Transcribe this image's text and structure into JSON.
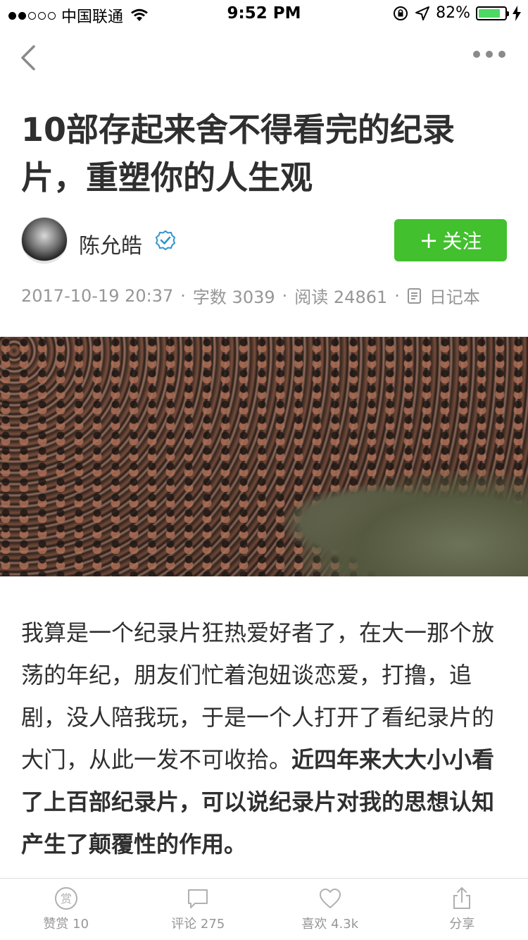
{
  "status_bar": {
    "carrier": "中国联通",
    "time": "9:52 PM",
    "battery": "82%",
    "battery_level": 0.82,
    "signal_bars_filled": 2,
    "signal_bars_total": 5
  },
  "nav": {
    "back_icon": "chevron-left-icon",
    "more_icon": "more-dots-icon"
  },
  "article": {
    "title": "10部存起来舍不得看完的纪录片，重塑你的人生观",
    "author": "陈允皓",
    "verified_icon": "verified-check-icon",
    "follow_label": "关注",
    "date": "2017-10-19 20:37",
    "word_count": "字数 3039",
    "read_count": "阅读 24861",
    "collection": "日记本",
    "body_normal": "我算是一个纪录片狂热爱好者了，在大一那个放荡的年纪，朋友们忙着泡妞谈恋爱，打撸，追剧，没人陪我玩，于是一个人打开了看纪录片的大门，从此一发不可收拾。",
    "body_bold": "近四年来大大小小看了上百部纪录片，可以说纪录片对我的思想认知产生了颠覆性的作用。"
  },
  "bottom_bar": {
    "reward": "赞赏 10",
    "comment": "评论 275",
    "like": "喜欢 4.3k",
    "share": "分享"
  },
  "colors": {
    "follow_green": "#42c02e",
    "meta_gray": "#969696",
    "verified_blue": "#3194d0"
  }
}
